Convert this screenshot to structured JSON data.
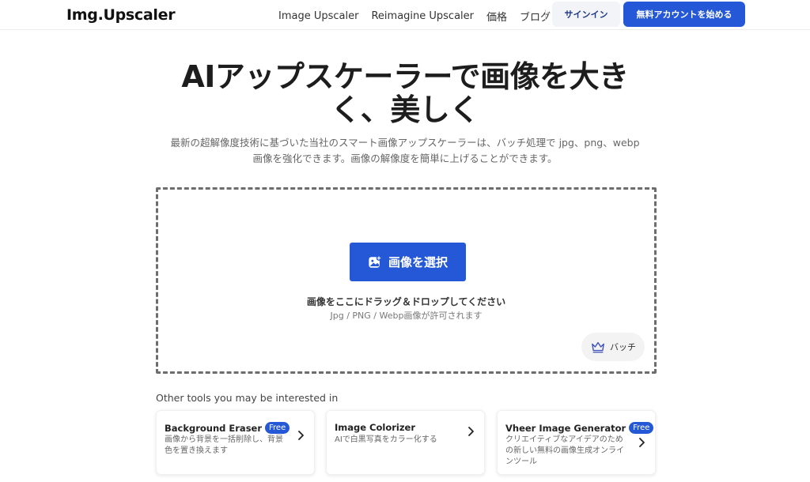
{
  "header": {
    "logo": "Img.Upscaler",
    "nav": [
      {
        "label": "Image Upscaler"
      },
      {
        "label": "Reimagine Upscaler"
      },
      {
        "label": "価格"
      },
      {
        "label": "ブログ"
      }
    ],
    "signin_label": "サインイン",
    "signup_label": "無料アカウントを始める"
  },
  "hero": {
    "title_line1": "AIアップスケーラーで画像を大き",
    "title_line2": "く、美しく",
    "subtitle_line1": "最新の超解像度技術に基づいた当社のスマート画像アップスケーラーは、バッチ処理で jpg、png、webp",
    "subtitle_line2": "画像を強化できます。画像の解像度を簡単に上げることができます。"
  },
  "upload": {
    "select_label": "画像を選択",
    "drop_text": "画像をここにドラッグ＆ドロップしてください",
    "allowed_text": "Jpg / PNG / Webp画像が許可されます",
    "batch_label": "バッチ"
  },
  "other_tools": {
    "title": "Other tools you may be interested in",
    "cards": [
      {
        "title": "Background Eraser",
        "badge": "Free",
        "desc_line1": "画像から背景を一括削除し、背景",
        "desc_line2": "色を置き換えます",
        "desc_line3": ""
      },
      {
        "title": "Image Colorizer",
        "badge": "",
        "desc_line1": "AIで白黒写真をカラー化する",
        "desc_line2": "",
        "desc_line3": ""
      },
      {
        "title": "Vheer Image Generator",
        "badge": "Free",
        "desc_line1": "クリエイティブなアイデアのため",
        "desc_line2": "の新しい無料の画像生成オンライ",
        "desc_line3": "ンツール"
      }
    ]
  },
  "colors": {
    "accent": "#2458d6",
    "signin_bg": "#f2f4f8"
  },
  "icons": {
    "select_button": "image-plus-icon",
    "batch_button": "crown-icon",
    "card_arrow": "chevron-right-icon"
  }
}
